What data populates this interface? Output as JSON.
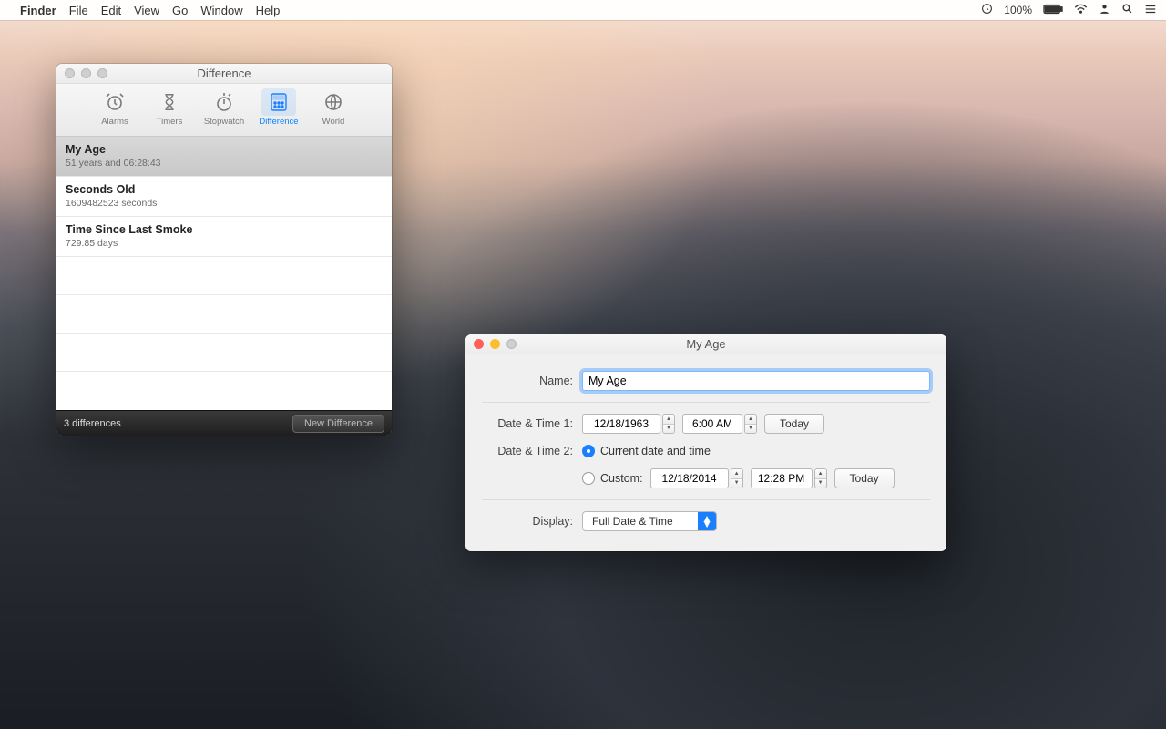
{
  "menubar": {
    "app": "Finder",
    "items": [
      "File",
      "Edit",
      "View",
      "Go",
      "Window",
      "Help"
    ],
    "battery": "100%"
  },
  "diff_window": {
    "title": "Difference",
    "toolbar": [
      "Alarms",
      "Timers",
      "Stopwatch",
      "Difference",
      "World"
    ],
    "rows": [
      {
        "title": "My Age",
        "sub": "51 years and 06:28:43"
      },
      {
        "title": "Seconds Old",
        "sub": "1609482523 seconds"
      },
      {
        "title": "Time Since Last Smoke",
        "sub": "729.85 days"
      }
    ],
    "status": "3 differences",
    "new_btn": "New Difference"
  },
  "edit_window": {
    "title": "My Age",
    "labels": {
      "name": "Name:",
      "dt1": "Date & Time 1:",
      "dt2": "Date & Time 2:",
      "display": "Display:"
    },
    "name_value": "My Age",
    "dt1": {
      "date": "12/18/1963",
      "time": "6:00 AM",
      "today": "Today"
    },
    "dt2": {
      "current_label": "Current date and time",
      "custom_label": "Custom:",
      "date": "12/18/2014",
      "time": "12:28 PM",
      "today": "Today"
    },
    "display_value": "Full Date & Time"
  }
}
